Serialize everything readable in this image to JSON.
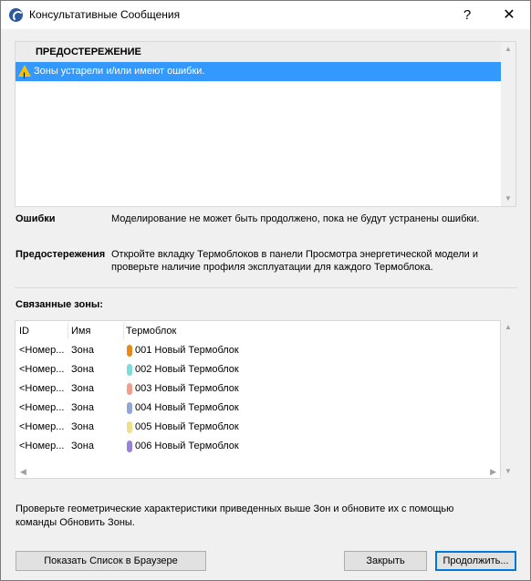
{
  "window": {
    "title": "Консультативные Сообщения",
    "help_label": "?",
    "close_label": "✕"
  },
  "messages": {
    "header": "ПРЕДОСТЕРЕЖЕНИЕ",
    "items": [
      {
        "icon": "warning-icon",
        "text": "Зоны устарели и/или имеют ошибки."
      }
    ]
  },
  "details": {
    "errors_label": "Ошибки",
    "errors_text": "Моделирование не может быть продолжено, пока не будут устранены ошибки.",
    "warnings_label": "Предостережения",
    "warnings_text_line1": "Откройте вкладку Термоблоков в панели Просмотра энергетической модели и",
    "warnings_text_line2": "проверьте наличие профиля эксплуатации для каждого Термоблока."
  },
  "zones": {
    "title": "Связанные зоны:",
    "columns": [
      "ID",
      "Имя",
      "Термоблок"
    ],
    "rows": [
      {
        "id": "<Номер...",
        "name": "Зона",
        "block": "001 Новый Термоблок",
        "color": "#e58a1e"
      },
      {
        "id": "<Номер...",
        "name": "Зона",
        "block": "002 Новый Термоблок",
        "color": "#7fdcdc"
      },
      {
        "id": "<Номер...",
        "name": "Зона",
        "block": "003 Новый Термоблок",
        "color": "#eea090"
      },
      {
        "id": "<Номер...",
        "name": "Зона",
        "block": "004 Новый Термоблок",
        "color": "#8fa8d8"
      },
      {
        "id": "<Номер...",
        "name": "Зона",
        "block": "005 Новый Термоблок",
        "color": "#ece08c"
      },
      {
        "id": "<Номер...",
        "name": "Зона",
        "block": "006 Новый Термоблок",
        "color": "#9a80d8"
      }
    ]
  },
  "hint": {
    "line1": "Проверьте геометрические характеристики приведенных выше Зон и обновите их с помощью",
    "line2": "команды Обновить Зоны."
  },
  "buttons": {
    "show_list": "Показать Список в Браузере",
    "close": "Закрыть",
    "continue": "Продолжить..."
  },
  "colors": {
    "selection": "#3399ff",
    "default_button_border": "#0078d7"
  }
}
